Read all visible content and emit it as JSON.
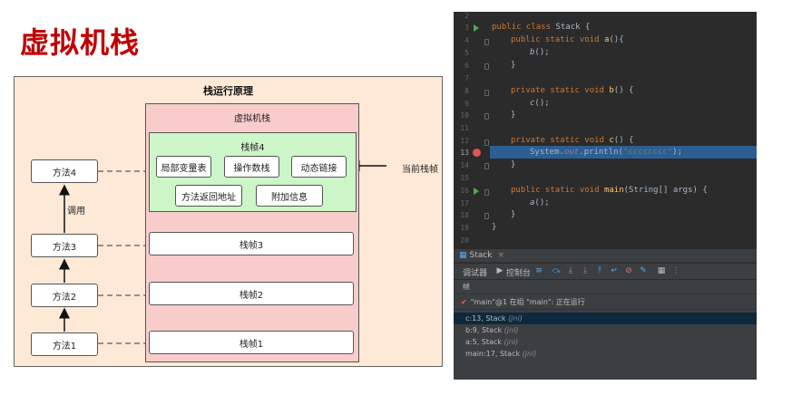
{
  "page_title": "虚拟机栈",
  "diagram": {
    "title": "栈运行原理",
    "jvm_stack_label": "虚拟机栈",
    "frame4": {
      "title": "栈帧4",
      "locals": "局部变量表",
      "operand": "操作数栈",
      "dynlink": "动态链接",
      "ret_addr": "方法返回地址",
      "extra": "附加信息"
    },
    "frames": [
      "栈帧3",
      "栈帧2",
      "栈帧1"
    ],
    "methods": [
      "方法4",
      "方法3",
      "方法2",
      "方法1"
    ],
    "call_label": "调用",
    "current_frame_label": "当前栈帧"
  },
  "ide": {
    "line_numbers": [
      "2",
      "3",
      "4",
      "5",
      "6",
      "7",
      "8",
      "9",
      "10",
      "11",
      "12",
      "13",
      "14",
      "15",
      "16",
      "17",
      "18",
      "19",
      "20"
    ],
    "debug_tab": "Stack",
    "toolbar": {
      "debugger_tab": "调试器",
      "console_tab": "控制台"
    },
    "frames_header": "帧",
    "thread": "\"main\"@1 在组 \"main\": 正在运行",
    "stack_frames": [
      {
        "loc": "c:13, Stack",
        "tag": "(jni)"
      },
      {
        "loc": "b:9, Stack",
        "tag": "(jni)"
      },
      {
        "loc": "a:5, Stack",
        "tag": "(jni)"
      },
      {
        "loc": "main:17, Stack",
        "tag": "(jni)"
      }
    ],
    "code": {
      "l3_kw": "public class ",
      "l3_name": "Stack",
      "l3_rest": " {",
      "l4_kw": "public static void ",
      "l4_fn": "a",
      "l4_rest": "(){",
      "l5_call": "b",
      "l5_rest": "();",
      "l6": "}",
      "l8_kw": "private static void ",
      "l8_fn": "b",
      "l8_rest": "() {",
      "l9_call": "c",
      "l9_rest": "();",
      "l10": "}",
      "l12_kw": "private static void ",
      "l12_fn": "c",
      "l12_rest": "() {",
      "l13_a": "System.",
      "l13_out": "out",
      "l13_b": ".println(",
      "l13_str": "\"cccccccc\"",
      "l13_c": ");",
      "l14": "}",
      "l16_kw": "public static void ",
      "l16_fn": "main",
      "l16_rest": "(String[] args) {",
      "l17_call": "a",
      "l17_rest": "();",
      "l18": "}",
      "l19": "}"
    }
  }
}
